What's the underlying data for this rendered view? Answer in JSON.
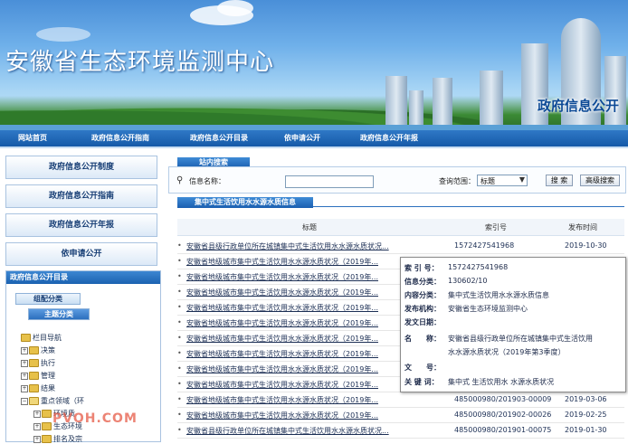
{
  "banner": {
    "title": "安徽省生态环境监测中心",
    "subtitle": "政府信息公开"
  },
  "nav": {
    "items": [
      "网站首页",
      "政府信息公开指南",
      "政府信息公开目录",
      "依申请公开",
      "政府信息公开年报"
    ]
  },
  "left_menu": {
    "buttons": [
      "政府信息公开制度",
      "政府信息公开指南",
      "政府信息公开年报",
      "依申请公开"
    ],
    "catalog_title": "政府信息公开目录",
    "tag_org": "组配分类",
    "tag_topic": "主题分类",
    "tree": [
      "栏目导航",
      "决策",
      "执行",
      "管理",
      "结果",
      "重点领域（环",
      "环境质",
      "生态环境",
      "排名及宗"
    ]
  },
  "search": {
    "tab_label": "站内搜索",
    "name_label": "信息名称：",
    "name_value": "",
    "scope_label": "查询范围：",
    "scope_value": "标题",
    "search_button": "搜 索",
    "advanced_button": "高级搜索"
  },
  "section": {
    "tab_label": "集中式生活饮用水水源水质信息"
  },
  "table": {
    "headers": [
      "标题",
      "索引号",
      "发布时间"
    ],
    "rows": [
      {
        "title": "安徽省县级行政单位所在城镇集中式生活饮用水水源水质状况...",
        "index": "1572427541968",
        "date": "2019-10-30"
      },
      {
        "title": "安徽省地级城市集中式生活饮用水水源水质状况（2019年...",
        "index": "",
        "date": ""
      },
      {
        "title": "安徽省地级城市集中式生活饮用水水源水质状况（2019年...",
        "index": "",
        "date": ""
      },
      {
        "title": "安徽省地级城市集中式生活饮用水水源水质状况（2019年...",
        "index": "",
        "date": ""
      },
      {
        "title": "安徽省地级城市集中式生活饮用水水源水质状况（2019年...",
        "index": "",
        "date": ""
      },
      {
        "title": "安徽省地级城市集中式生活饮用水水源水质状况（2019年...",
        "index": "",
        "date": ""
      },
      {
        "title": "安徽省地级城市集中式生活饮用水水源水质状况（2019年...",
        "index": "",
        "date": ""
      },
      {
        "title": "安徽省地级城市集中式生活饮用水水源水质状况（2019年...",
        "index": "",
        "date": ""
      },
      {
        "title": "安徽省地级城市集中式生活饮用水水源水质状况（2019年...",
        "index": "",
        "date": ""
      },
      {
        "title": "安徽省地级城市集中式生活饮用水水源水质状况（2019年...",
        "index": "",
        "date": ""
      },
      {
        "title": "安徽省地级城市集中式生活饮用水水源水质状况（2019年...",
        "index": "485000980/201903-00009",
        "date": "2019-03-06"
      },
      {
        "title": "安徽省地级城市集中式生活饮用水水源水质状况（2019年...",
        "index": "485000980/201902-00026",
        "date": "2019-02-25"
      },
      {
        "title": "安徽省县级行政单位所在城镇集中式生活饮用水水源水质状况...",
        "index": "485000980/201901-00075",
        "date": "2019-01-30"
      }
    ]
  },
  "popup": {
    "rows": [
      {
        "key": "索 引 号：",
        "value": "1572427541968"
      },
      {
        "key": "信息分类：",
        "value": "130602/10"
      },
      {
        "key": "内容分类：",
        "value": "集中式生活饮用水水源水质信息"
      },
      {
        "key": "发布机构：",
        "value": "安徽省生态环境监测中心"
      },
      {
        "key": "发文日期：",
        "value": ""
      },
      {
        "key": "名　　称：",
        "value": "安徽省县级行政单位所在城镇集中式生活饮用"
      },
      {
        "key": "",
        "value": "水水源水质状况（2019年第3季度）"
      },
      {
        "key": "文　　号：",
        "value": ""
      },
      {
        "key": "关 键 词：",
        "value": "集中式 生活饮用水 水源水质状况"
      }
    ]
  },
  "watermark": "PVOH.COM",
  "colors": {
    "nav_blue": "#1f6bbd",
    "link_text": "#1c2f55",
    "watermark": "#e65a46"
  }
}
